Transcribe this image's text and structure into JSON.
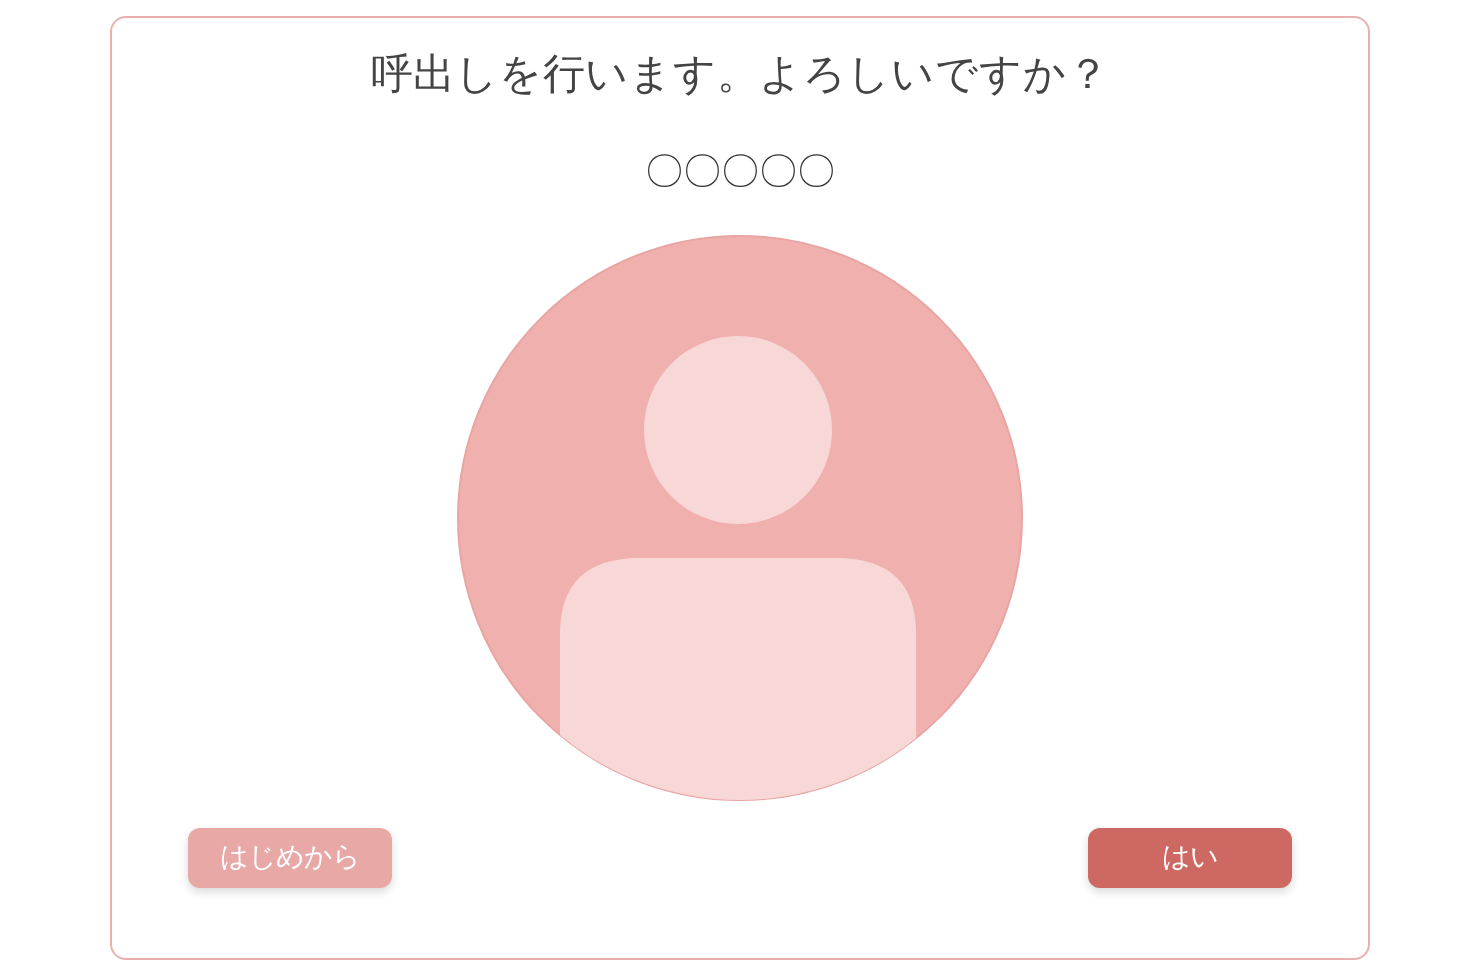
{
  "title": "呼出しを行います。よろしいですか？",
  "name": "〇〇〇〇〇",
  "buttons": [
    {
      "label": "はじめから",
      "kind": "secondary"
    },
    {
      "label": "はい",
      "kind": "primary"
    }
  ]
}
